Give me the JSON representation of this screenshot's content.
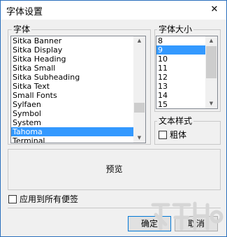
{
  "window": {
    "title": "字体设置",
    "close_glyph": "✕"
  },
  "font": {
    "group_label": "字体",
    "items": [
      "Sitka Banner",
      "Sitka Display",
      "Sitka Heading",
      "Sitka Small",
      "Sitka Subheading",
      "Sitka Text",
      "Small Fonts",
      "Sylfaen",
      "Symbol",
      "System",
      "Tahoma",
      "Terminal"
    ],
    "selected": "Tahoma",
    "scroll_position": 0.9
  },
  "size": {
    "group_label": "字体大小",
    "items": [
      "8",
      "9",
      "10",
      "11",
      "12",
      "13",
      "14",
      "15"
    ],
    "selected": "9",
    "scroll_position": 0.0
  },
  "style": {
    "group_label": "文本样式",
    "bold_label": "粗体",
    "bold_checked": false
  },
  "preview": {
    "text": "预览"
  },
  "apply_all": {
    "label": "应用到所有便签",
    "checked": false
  },
  "buttons": {
    "ok": "确定",
    "cancel": "取消"
  },
  "colors": {
    "accent": "#3399ff",
    "frame": "#2a6fbd"
  }
}
